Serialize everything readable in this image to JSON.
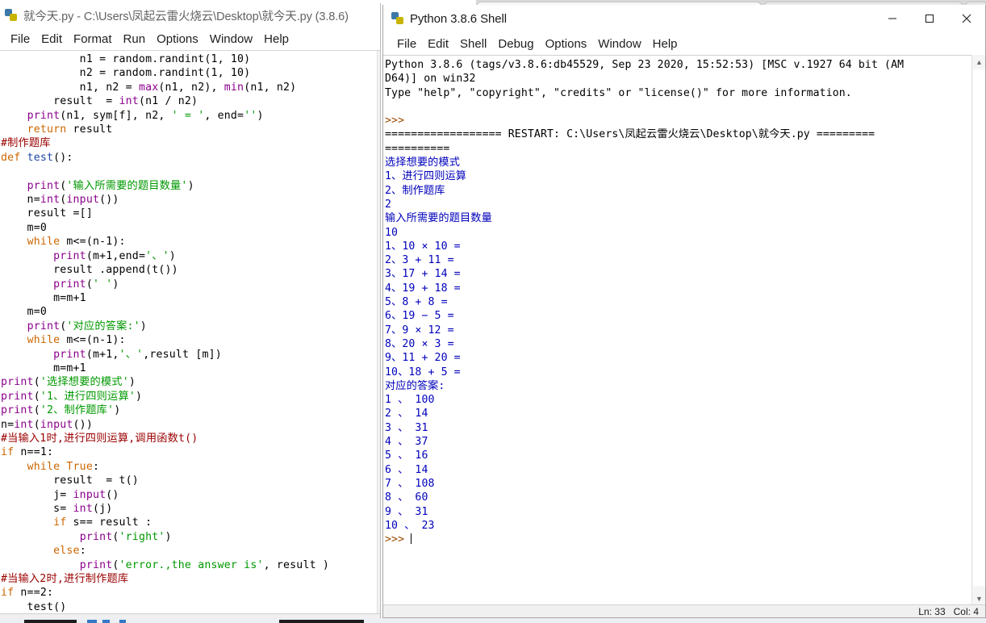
{
  "background_window": {
    "tabs": [
      "",
      "",
      ""
    ]
  },
  "editor": {
    "title": "就今天.py - C:\\Users\\凤起云雷火烧云\\Desktop\\就今天.py (3.8.6)",
    "icon": "python-icon",
    "menu": [
      "File",
      "Edit",
      "Format",
      "Run",
      "Options",
      "Window",
      "Help"
    ],
    "code_lines": [
      [
        {
          "t": "            n1 = random.randint(1, 10)",
          "c": "plain"
        }
      ],
      [
        {
          "t": "            n2 = random.randint(1, 10)",
          "c": "plain"
        }
      ],
      [
        {
          "t": "            n1, n2 = ",
          "c": "plain"
        },
        {
          "t": "max",
          "c": "builtin"
        },
        {
          "t": "(n1, n2), ",
          "c": "plain"
        },
        {
          "t": "min",
          "c": "builtin"
        },
        {
          "t": "(n1, n2)",
          "c": "plain"
        }
      ],
      [
        {
          "t": "        result  = ",
          "c": "plain"
        },
        {
          "t": "int",
          "c": "builtin"
        },
        {
          "t": "(n1 / n2)",
          "c": "plain"
        }
      ],
      [
        {
          "t": "    ",
          "c": "plain"
        },
        {
          "t": "print",
          "c": "builtin"
        },
        {
          "t": "(n1, sym[f], n2, ",
          "c": "plain"
        },
        {
          "t": "' = '",
          "c": "str"
        },
        {
          "t": ", end=",
          "c": "plain"
        },
        {
          "t": "''",
          "c": "str"
        },
        {
          "t": ")",
          "c": "plain"
        }
      ],
      [
        {
          "t": "    ",
          "c": "plain"
        },
        {
          "t": "return",
          "c": "kw"
        },
        {
          "t": " result",
          "c": "plain"
        }
      ],
      [
        {
          "t": "#制作题库",
          "c": "com"
        }
      ],
      [
        {
          "t": "def",
          "c": "kw"
        },
        {
          "t": " ",
          "c": "plain"
        },
        {
          "t": "test",
          "c": "fn"
        },
        {
          "t": "():",
          "c": "plain"
        }
      ],
      [
        {
          "t": "",
          "c": "plain"
        }
      ],
      [
        {
          "t": "    ",
          "c": "plain"
        },
        {
          "t": "print",
          "c": "builtin"
        },
        {
          "t": "(",
          "c": "plain"
        },
        {
          "t": "'输入所需要的题目数量'",
          "c": "str"
        },
        {
          "t": ")",
          "c": "plain"
        }
      ],
      [
        {
          "t": "    n=",
          "c": "plain"
        },
        {
          "t": "int",
          "c": "builtin"
        },
        {
          "t": "(",
          "c": "plain"
        },
        {
          "t": "input",
          "c": "builtin"
        },
        {
          "t": "())",
          "c": "plain"
        }
      ],
      [
        {
          "t": "    result =[]",
          "c": "plain"
        }
      ],
      [
        {
          "t": "    m=0",
          "c": "plain"
        }
      ],
      [
        {
          "t": "    ",
          "c": "plain"
        },
        {
          "t": "while",
          "c": "kw"
        },
        {
          "t": " m<=(n-1):",
          "c": "plain"
        }
      ],
      [
        {
          "t": "        ",
          "c": "plain"
        },
        {
          "t": "print",
          "c": "builtin"
        },
        {
          "t": "(m+1,end=",
          "c": "plain"
        },
        {
          "t": "'、'",
          "c": "str"
        },
        {
          "t": ")",
          "c": "plain"
        }
      ],
      [
        {
          "t": "        result .append(t())",
          "c": "plain"
        }
      ],
      [
        {
          "t": "        ",
          "c": "plain"
        },
        {
          "t": "print",
          "c": "builtin"
        },
        {
          "t": "(",
          "c": "plain"
        },
        {
          "t": "' '",
          "c": "str"
        },
        {
          "t": ")",
          "c": "plain"
        }
      ],
      [
        {
          "t": "        m=m+1",
          "c": "plain"
        }
      ],
      [
        {
          "t": "    m=0",
          "c": "plain"
        }
      ],
      [
        {
          "t": "    ",
          "c": "plain"
        },
        {
          "t": "print",
          "c": "builtin"
        },
        {
          "t": "(",
          "c": "plain"
        },
        {
          "t": "'对应的答案:'",
          "c": "str"
        },
        {
          "t": ")",
          "c": "plain"
        }
      ],
      [
        {
          "t": "    ",
          "c": "plain"
        },
        {
          "t": "while",
          "c": "kw"
        },
        {
          "t": " m<=(n-1):",
          "c": "plain"
        }
      ],
      [
        {
          "t": "        ",
          "c": "plain"
        },
        {
          "t": "print",
          "c": "builtin"
        },
        {
          "t": "(m+1,",
          "c": "plain"
        },
        {
          "t": "'、'",
          "c": "str"
        },
        {
          "t": ",result [m])",
          "c": "plain"
        }
      ],
      [
        {
          "t": "        m=m+1",
          "c": "plain"
        }
      ],
      [
        {
          "t": "",
          "c": "plain"
        },
        {
          "t": "print",
          "c": "builtin"
        },
        {
          "t": "(",
          "c": "plain"
        },
        {
          "t": "'选择想要的模式'",
          "c": "str"
        },
        {
          "t": ")",
          "c": "plain"
        }
      ],
      [
        {
          "t": "",
          "c": "plain"
        },
        {
          "t": "print",
          "c": "builtin"
        },
        {
          "t": "(",
          "c": "plain"
        },
        {
          "t": "'1、进行四则运算'",
          "c": "str"
        },
        {
          "t": ")",
          "c": "plain"
        }
      ],
      [
        {
          "t": "",
          "c": "plain"
        },
        {
          "t": "print",
          "c": "builtin"
        },
        {
          "t": "(",
          "c": "plain"
        },
        {
          "t": "'2、制作题库'",
          "c": "str"
        },
        {
          "t": ")",
          "c": "plain"
        }
      ],
      [
        {
          "t": "n=",
          "c": "plain"
        },
        {
          "t": "int",
          "c": "builtin"
        },
        {
          "t": "(",
          "c": "plain"
        },
        {
          "t": "input",
          "c": "builtin"
        },
        {
          "t": "())",
          "c": "plain"
        }
      ],
      [
        {
          "t": "#当输入1时,进行四则运算,调用函数t()",
          "c": "com"
        }
      ],
      [
        {
          "t": "if",
          "c": "kw"
        },
        {
          "t": " n==1:",
          "c": "plain"
        }
      ],
      [
        {
          "t": "    ",
          "c": "plain"
        },
        {
          "t": "while",
          "c": "kw"
        },
        {
          "t": " ",
          "c": "plain"
        },
        {
          "t": "True",
          "c": "kw"
        },
        {
          "t": ":",
          "c": "plain"
        }
      ],
      [
        {
          "t": "        result  = t()",
          "c": "plain"
        }
      ],
      [
        {
          "t": "        j= ",
          "c": "plain"
        },
        {
          "t": "input",
          "c": "builtin"
        },
        {
          "t": "()",
          "c": "plain"
        }
      ],
      [
        {
          "t": "        s= ",
          "c": "plain"
        },
        {
          "t": "int",
          "c": "builtin"
        },
        {
          "t": "(j)",
          "c": "plain"
        }
      ],
      [
        {
          "t": "        ",
          "c": "plain"
        },
        {
          "t": "if",
          "c": "kw"
        },
        {
          "t": " s== result :",
          "c": "plain"
        }
      ],
      [
        {
          "t": "            ",
          "c": "plain"
        },
        {
          "t": "print",
          "c": "builtin"
        },
        {
          "t": "(",
          "c": "plain"
        },
        {
          "t": "'right'",
          "c": "str"
        },
        {
          "t": ")",
          "c": "plain"
        }
      ],
      [
        {
          "t": "        ",
          "c": "plain"
        },
        {
          "t": "else",
          "c": "kw"
        },
        {
          "t": ":",
          "c": "plain"
        }
      ],
      [
        {
          "t": "            ",
          "c": "plain"
        },
        {
          "t": "print",
          "c": "builtin"
        },
        {
          "t": "(",
          "c": "plain"
        },
        {
          "t": "'error.,the answer is'",
          "c": "str"
        },
        {
          "t": ", result )",
          "c": "plain"
        }
      ],
      [
        {
          "t": "#当输入2时,进行制作题库",
          "c": "com"
        }
      ],
      [
        {
          "t": "if",
          "c": "kw"
        },
        {
          "t": " n==2:",
          "c": "plain"
        }
      ],
      [
        {
          "t": "    test()",
          "c": "plain"
        }
      ]
    ]
  },
  "shell": {
    "title": "Python 3.8.6 Shell",
    "icon": "python-icon",
    "menu": [
      "File",
      "Edit",
      "Shell",
      "Debug",
      "Options",
      "Window",
      "Help"
    ],
    "window_buttons": {
      "minimize": "minimize-icon",
      "maximize": "maximize-icon",
      "close": "close-icon"
    },
    "output_lines": [
      {
        "t": "Python 3.8.6 (tags/v3.8.6:db45529, Sep 23 2020, 15:52:53) [MSC v.1927 64 bit (AM",
        "c": "banner"
      },
      {
        "t": "D64)] on win32",
        "c": "banner"
      },
      {
        "t": "Type \"help\", \"copyright\", \"credits\" or \"license()\" for more information.",
        "c": "banner"
      },
      {
        "t": "",
        "c": "banner"
      },
      {
        "t": ">>> ",
        "c": "prompt"
      },
      {
        "t": "================== RESTART: C:\\Users\\凤起云雷火烧云\\Desktop\\就今天.py =========",
        "c": "restart"
      },
      {
        "t": "==========",
        "c": "restart"
      },
      {
        "t": "选择想要的模式",
        "c": "out"
      },
      {
        "t": "1、进行四则运算",
        "c": "out"
      },
      {
        "t": "2、制作题库",
        "c": "out"
      },
      {
        "t": "2",
        "c": "out"
      },
      {
        "t": "输入所需要的题目数量",
        "c": "out"
      },
      {
        "t": "10",
        "c": "out"
      },
      {
        "t": "1、10 × 10 = ",
        "c": "out"
      },
      {
        "t": "2、3 + 11 = ",
        "c": "out"
      },
      {
        "t": "3、17 + 14 = ",
        "c": "out"
      },
      {
        "t": "4、19 + 18 = ",
        "c": "out"
      },
      {
        "t": "5、8 + 8 = ",
        "c": "out"
      },
      {
        "t": "6、19 − 5 = ",
        "c": "out"
      },
      {
        "t": "7、9 × 12 = ",
        "c": "out"
      },
      {
        "t": "8、20 × 3 = ",
        "c": "out"
      },
      {
        "t": "9、11 + 20 = ",
        "c": "out"
      },
      {
        "t": "10、18 + 5 = ",
        "c": "out"
      },
      {
        "t": "对应的答案:",
        "c": "out"
      },
      {
        "t": "1 、 100",
        "c": "out"
      },
      {
        "t": "2 、 14",
        "c": "out"
      },
      {
        "t": "3 、 31",
        "c": "out"
      },
      {
        "t": "4 、 37",
        "c": "out"
      },
      {
        "t": "5 、 16",
        "c": "out"
      },
      {
        "t": "6 、 14",
        "c": "out"
      },
      {
        "t": "7 、 108",
        "c": "out"
      },
      {
        "t": "8 、 60",
        "c": "out"
      },
      {
        "t": "9 、 31",
        "c": "out"
      },
      {
        "t": "10 、 23",
        "c": "out"
      }
    ],
    "final_prompt": ">>> ",
    "statusbar": {
      "line": "Ln: 33",
      "col": "Col: 4"
    }
  },
  "colors": {
    "keyword": "#cc6600",
    "builtin": "#8b008b",
    "string": "#009900",
    "comment": "#9b0000",
    "definition": "#1d47a6",
    "stdout": "#0000bb",
    "prompt": "#9b4a00"
  }
}
